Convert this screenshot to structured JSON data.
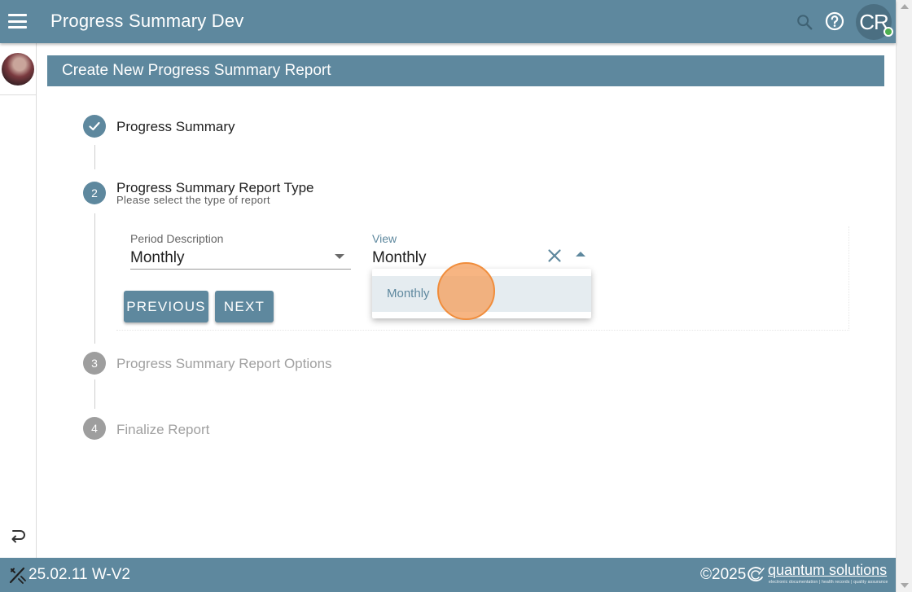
{
  "header": {
    "app_title": "Progress Summary Dev",
    "avatar_initials": "CR",
    "menu_icon": "hamburger-menu-icon",
    "search_icon": "search-icon",
    "help_icon": "help-circle-icon"
  },
  "card": {
    "title": "Create New Progress Summary Report"
  },
  "stepper": {
    "steps": [
      {
        "number": "",
        "title": "Progress Summary",
        "state": "completed"
      },
      {
        "number": "2",
        "title": "Progress Summary Report Type",
        "subtitle": "Please select the type of report",
        "state": "active"
      },
      {
        "number": "3",
        "title": "Progress Summary Report Options",
        "state": "inactive"
      },
      {
        "number": "4",
        "title": "Finalize Report",
        "state": "inactive"
      }
    ]
  },
  "form": {
    "period_description": {
      "label": "Period Description",
      "value": "Monthly"
    },
    "view": {
      "label": "View",
      "value": "Monthly"
    },
    "dropdown_options": [
      "Monthly"
    ],
    "previous_label": "PREVIOUS",
    "next_label": "NEXT"
  },
  "footer": {
    "version": "25.02.11 W-V2",
    "copyright": "©2025",
    "brand_name": "quantum solutions",
    "brand_tagline": "electronic documentation | health records | quality assurance"
  },
  "colors": {
    "primary": "#5e889e",
    "inactive_step": "#9e9e9e",
    "selected_option_bg": "#e5ecf0",
    "click_marker": "#f5a05f",
    "online_status": "#4caf50"
  }
}
